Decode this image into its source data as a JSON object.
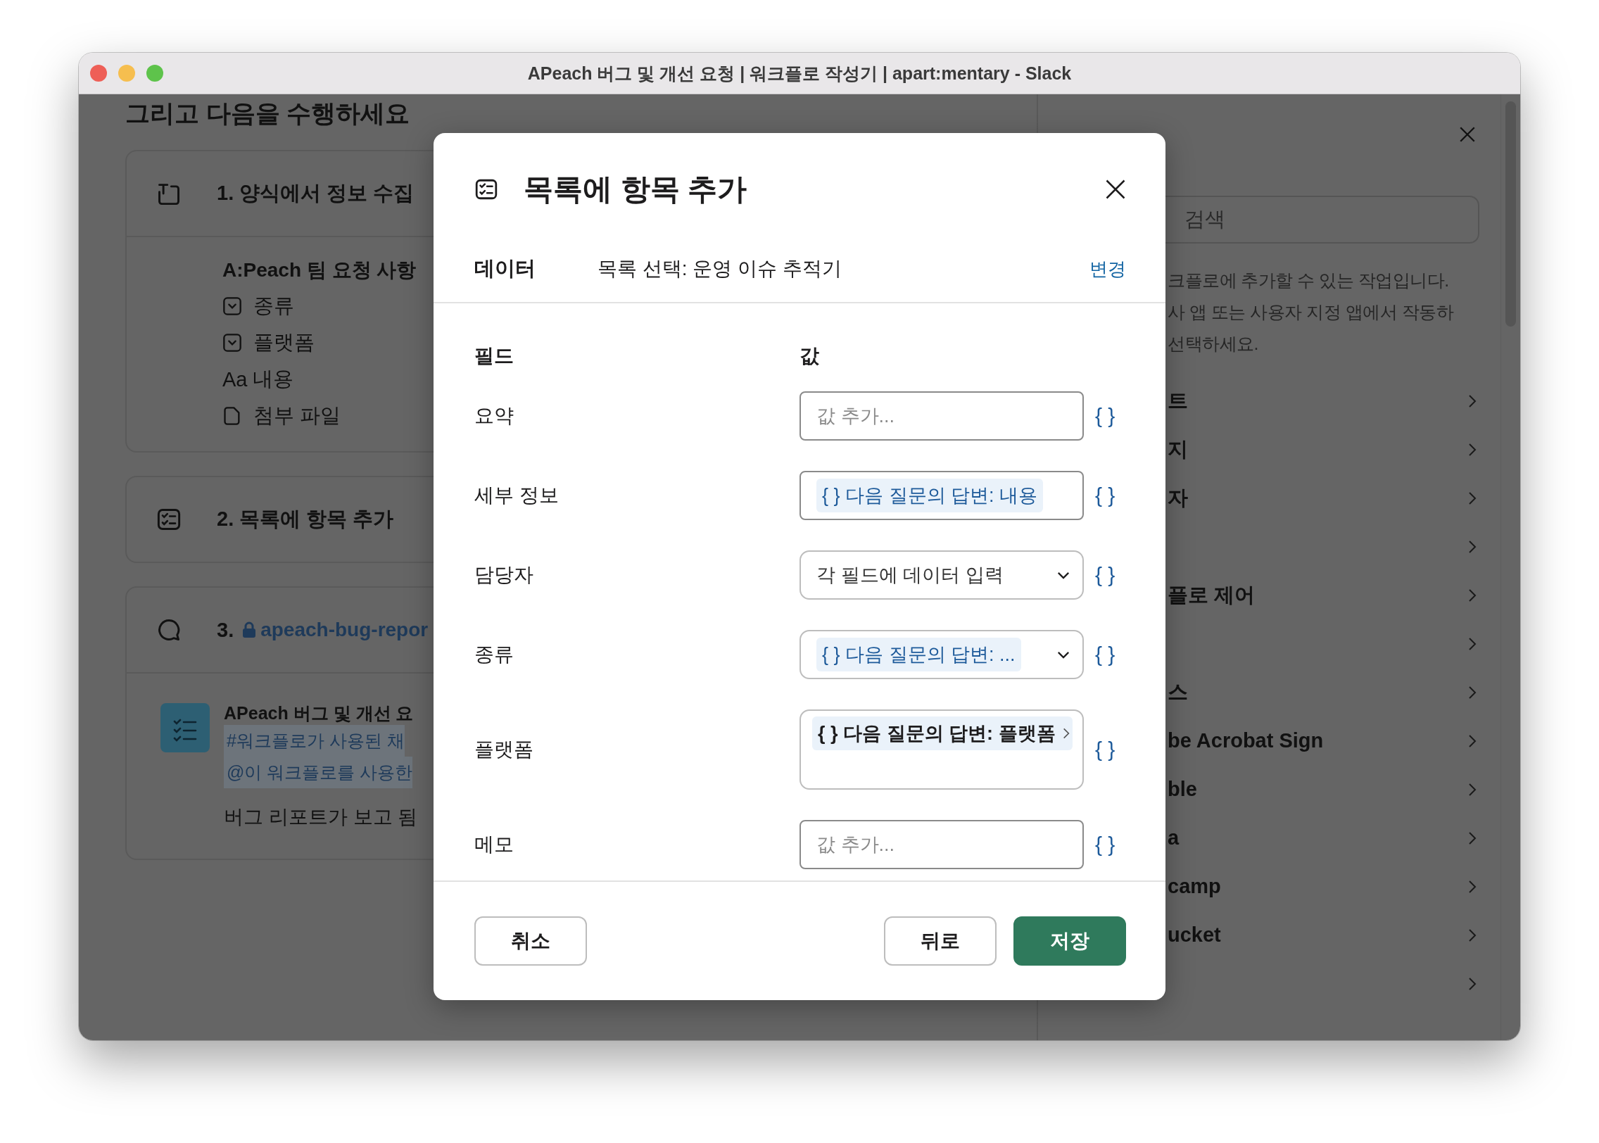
{
  "window": {
    "title": "APeach 버그 및 개선 요청 | 워크플로 작성기 | apart:mentary - Slack"
  },
  "builder": {
    "heading": "그리고 다음을 수행하세요",
    "steps": [
      {
        "kind": "form",
        "title": "1. 양식에서 정보 수집",
        "form_title": "A:Peach 팀 요청 사항",
        "fields": [
          {
            "kind": "select",
            "label": "종류"
          },
          {
            "kind": "select",
            "label": "플랫폼"
          },
          {
            "kind": "text",
            "glyph": "Aa",
            "label": "내용"
          },
          {
            "kind": "file",
            "label": "첨부 파일"
          }
        ]
      },
      {
        "kind": "list",
        "title": "2. 목록에 항목 추가"
      },
      {
        "kind": "message",
        "number": "3.",
        "channel": "apeach-bug-repor",
        "message": {
          "title": "APeach 버그 및 개선 요",
          "tokens": [
            "#워크플로가 사용된 채",
            "@이 워크플로를 사용한"
          ],
          "text": "버그 리포트가 보고 됨"
        }
      }
    ]
  },
  "steps_panel": {
    "search": {
      "placeholder": "검색"
    },
    "description": [
      "크플로에 추가할 수 있는 작업입니다.",
      "사 앱 또는 사용자 지정 앱에서 작동하",
      "선택하세요."
    ],
    "items": [
      {
        "kind": "labelled",
        "label": "트"
      },
      {
        "kind": "labelled",
        "label": "지"
      },
      {
        "kind": "labelled",
        "label": "자"
      },
      {
        "kind": "chevron-only"
      },
      {
        "kind": "labelled",
        "label": "플로 제어"
      },
      {
        "kind": "chevron-only"
      },
      {
        "kind": "labelled",
        "label": "스"
      },
      {
        "kind": "labelled",
        "label": "be Acrobat Sign"
      },
      {
        "kind": "labelled",
        "label": "ble"
      },
      {
        "kind": "labelled",
        "label": "a"
      },
      {
        "kind": "labelled",
        "label": "camp"
      },
      {
        "kind": "labelled",
        "label": "ucket"
      },
      {
        "kind": "chevron-only"
      }
    ]
  },
  "modal": {
    "title": "목록에 항목 추가",
    "data_label": "데이터",
    "data_value": "목록 선택: 운영 이슈 추적기",
    "change_link": "변경",
    "columns": [
      "필드",
      "값"
    ],
    "fields": [
      {
        "label": "요약",
        "kind": "input",
        "placeholder": "값 추가...",
        "insert": "{ }"
      },
      {
        "label": "세부 정보",
        "kind": "token",
        "value": "{ } 다음 질문의 답변: 내용",
        "insert": "{ }"
      },
      {
        "label": "담당자",
        "kind": "select",
        "value": "각 필드에 데이터 입력",
        "insert": "{ }"
      },
      {
        "label": "종류",
        "kind": "token-select",
        "value": "{ } 다음 질문의 답변: ...",
        "insert": "{ }"
      },
      {
        "label": "플랫폼",
        "kind": "token-area",
        "value": "{ } 다음 질문의 답변: 플랫폼",
        "insert": "{ }"
      },
      {
        "label": "메모",
        "kind": "input",
        "placeholder": "값 추가...",
        "insert": "{ }"
      }
    ],
    "buttons": [
      {
        "kind": "cancel",
        "label": "취소"
      },
      {
        "kind": "back",
        "label": "뒤로"
      },
      {
        "kind": "save",
        "label": "저장"
      }
    ]
  }
}
